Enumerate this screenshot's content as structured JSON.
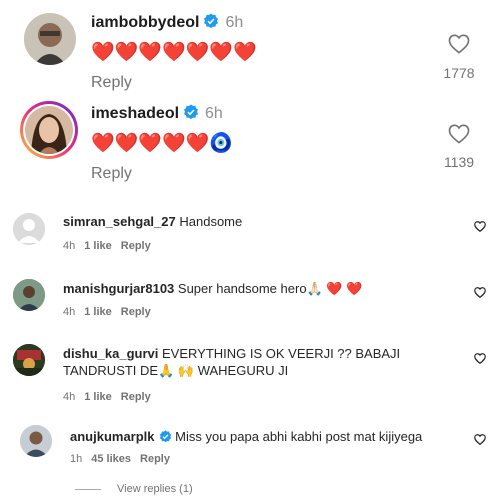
{
  "comments_top": [
    {
      "username": "iambobbydeol",
      "time": "6h",
      "hearts_text": "❤️❤️❤️❤️❤️❤️❤️",
      "reply_label": "Reply",
      "likes": "1778",
      "avatar_icon": "bobby-avatar-icon"
    },
    {
      "username": "imeshadeol",
      "time": "6h",
      "hearts_text": "❤️❤️❤️❤️❤️🧿",
      "reply_label": "Reply",
      "likes": "1139",
      "avatar_icon": "esha-avatar-icon"
    }
  ],
  "comments_small": [
    {
      "username": "simran_sehgal_27",
      "text": "Handsome",
      "time": "4h",
      "likes": "1 like",
      "reply_label": "Reply"
    },
    {
      "username": "manishgurjar8103",
      "text": "Super handsome hero🙏🏻 ❤️ ❤️",
      "time": "4h",
      "likes": "1 like",
      "reply_label": "Reply"
    },
    {
      "username": "dishu_ka_gurvi",
      "text": "EVERYTHING IS OK VEERJI ?? BABAJI TANDRUSTI DE🙏 🙌 WAHEGURU JI",
      "time": "4h",
      "likes": "1 like",
      "reply_label": "Reply"
    },
    {
      "username": "anujkumarplk",
      "text": "Miss you papa abhi kabhi post mat kijiyega",
      "time": "1h",
      "likes": "45 likes",
      "reply_label": "Reply"
    }
  ],
  "view_replies": "View replies (1)",
  "colors": {
    "verified": "#1d9bf0",
    "heart": "#e8262f",
    "muted": "#737373"
  }
}
